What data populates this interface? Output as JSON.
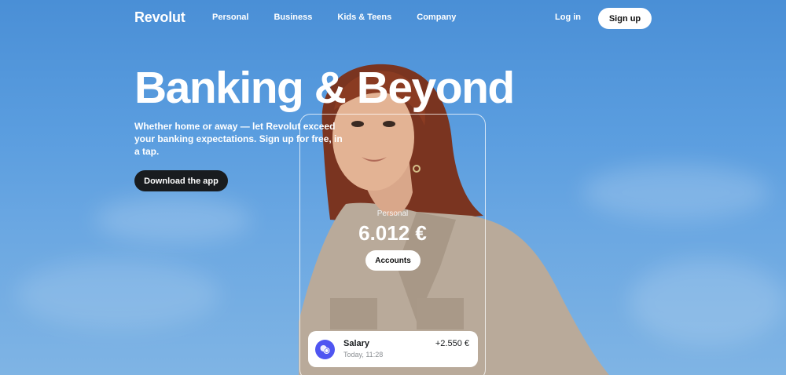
{
  "brand": {
    "name": "Revolut"
  },
  "nav": {
    "links": [
      "Personal",
      "Business",
      "Kids & Teens",
      "Company"
    ],
    "login": "Log in",
    "signup": "Sign up"
  },
  "hero": {
    "title": "Banking & Beyond",
    "subtitle": "Whether home or away — let Revolut exceed your banking expectations. Sign up for free, in a tap.",
    "cta": "Download the app"
  },
  "phone": {
    "account_label": "Personal",
    "balance": "6.012 €",
    "accounts_button": "Accounts",
    "transaction": {
      "name": "Salary",
      "time": "Today, 11:28",
      "amount": "+2.550 €",
      "icon": "coins-icon"
    }
  },
  "colors": {
    "sky": "#5a9ddf",
    "dark_button": "#191c1f",
    "tx_icon": "#4f55f1"
  }
}
